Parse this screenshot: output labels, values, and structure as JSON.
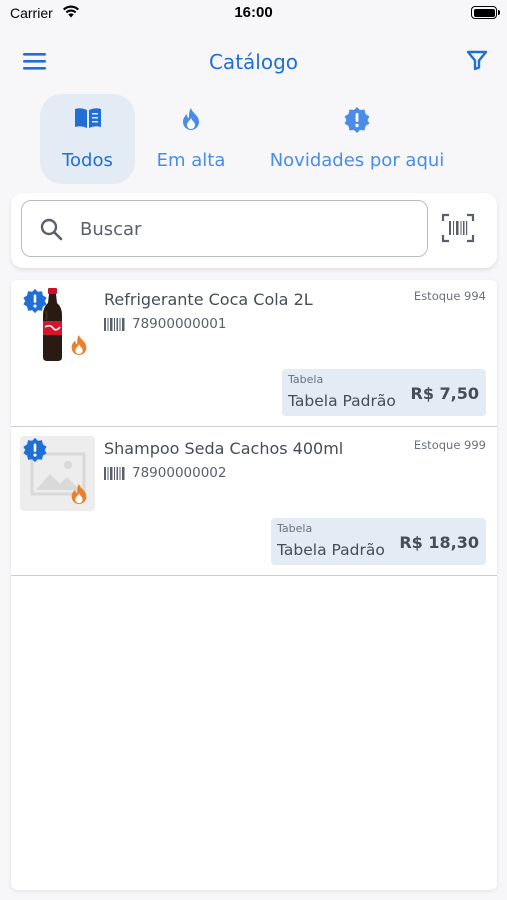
{
  "status_bar": {
    "carrier": "Carrier",
    "time": "16:00"
  },
  "header": {
    "title": "Catálogo"
  },
  "tabs": [
    {
      "label": "Todos",
      "icon": "book-icon",
      "active": true
    },
    {
      "label": "Em alta",
      "icon": "flame-icon",
      "active": false
    },
    {
      "label": "Novidades por aqui",
      "icon": "new-badge-icon",
      "active": false
    }
  ],
  "search": {
    "placeholder": "Buscar"
  },
  "products": [
    {
      "name": "Refrigerante Coca Cola 2L",
      "code": "78900000001",
      "stock": "Estoque 994",
      "price_label": "Tabela",
      "table": "Tabela Padrão",
      "price": "R$ 7,50",
      "image": "coca-cola-bottle"
    },
    {
      "name": "Shampoo Seda Cachos 400ml",
      "code": "78900000002",
      "stock": "Estoque 999",
      "price_label": "Tabela",
      "table": "Tabela Padrão",
      "price": "R$ 18,30",
      "image": "image-placeholder"
    }
  ],
  "colors": {
    "accent": "#1f6fd6",
    "tab_inactive": "#4a8ce8",
    "hot_badge": "#ef7d2c",
    "price_bg": "#e3ebf5"
  }
}
